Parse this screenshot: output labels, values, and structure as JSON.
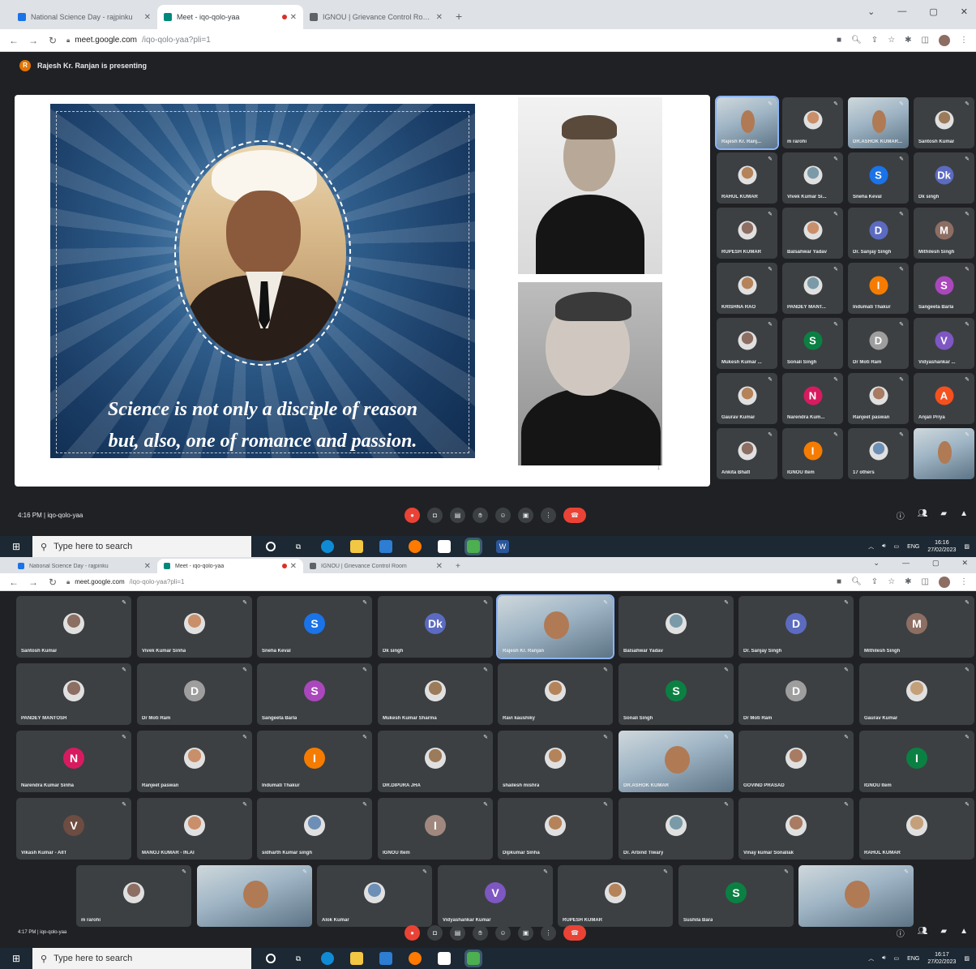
{
  "browser": {
    "tabs": [
      {
        "title": "National Science Day - rajpinku",
        "color": "#1a73e8"
      },
      {
        "title": "Meet - iqo-qolo-yaa",
        "color": "#00897b"
      },
      {
        "title": "IGNOU | Grievance Control Room",
        "color": "#5f6368"
      }
    ],
    "new_tab": "+",
    "url_host": "meet.google.com",
    "url_path": "/iqo-qolo-yaa?pli=1"
  },
  "shot1": {
    "presenting": "Rajesh Kr. Ranjan is presenting",
    "slide": {
      "quote_line1": "Science is not only a disciple of reason",
      "quote_line2": "but, also, one of romance and passion.",
      "page": "1"
    },
    "grid": [
      [
        "Rajesh Kr. Ranj...",
        "m rarohi",
        "DR.ASHOK KUMAR...",
        "Santosh Kumar"
      ],
      [
        "RAHUL KUMAR",
        "Vivek Kumar Si...",
        "Sneha Keval",
        "Dk singh"
      ],
      [
        "RUPESH KUMAR",
        "Balsahwar Yadav",
        "Dr. Sanjay Singh",
        "Mithilesh Singh"
      ],
      [
        "KRISHNA RAO",
        "PANDEY MANT...",
        "Indumati Thakur",
        "Sangeeta Barla"
      ],
      [
        "Mukesh Kumar ...",
        "Sonali Singh",
        "Dr Moti Ram",
        "Vidyashankar ..."
      ],
      [
        "Gaurav Kumar",
        "Narendra Kum...",
        "Ranjeet paswan",
        "Anjali Priya"
      ],
      [
        "Ankita Bhatt",
        "IGNOU Item",
        "17 others",
        ""
      ]
    ],
    "meeting_info": "4:16 PM | iqo-qolo-yaa",
    "search_placeholder": "Type here to search",
    "tray_lang": "ENG",
    "tray_time": "16:16",
    "tray_date": "27/02/2023"
  },
  "shot2": {
    "grid": [
      [
        "Santosh Kumar",
        "Vivek Kumar Sinha",
        "Sneha Keval",
        "Dk singh",
        "Rajesh Kr. Ranjan",
        "Balsahwar Yadav",
        "Dr. Sanjay Singh",
        "Mithilesh Singh"
      ],
      [
        "PANDEY MANTOSH",
        "Dr Moti Ram",
        "Sangeeta Barla",
        "Mukesh Kumar Sharma",
        "Ravi kaushiky",
        "Sonali Singh",
        "Dr Moti Ram",
        "Gaurav Kumar"
      ],
      [
        "Narendra Kumar Sinha",
        "Ranjeet paswan",
        "Indumati Thakur",
        "DR.DIPURA JHA",
        "shailesh mishra",
        "DR.ASHOK KUMAR",
        "GOVIND PRASAD",
        "IGNOU Item"
      ],
      [
        "Vikash Kumar - AIIT",
        "MANOJ KUMAR - IN.AI",
        "sidharth Kumar singh",
        "IGNOU Item",
        "Dipkumar Sinha",
        "Dr. Arbind Tiwary",
        "Vinay kumar Sonaliak",
        "RAHUL KUMAR"
      ],
      [
        "m rarohi",
        "",
        "Alok Kumar",
        "Vidyashankar Kumar",
        "RUPESH KUMAR",
        "Sushila Bara",
        ""
      ]
    ],
    "meeting_info": "4:17 PM | iqo-qolo-yaa",
    "search_placeholder": "Type here to search",
    "tray_lang": "ENG",
    "tray_time": "16:17",
    "tray_date": "27/02/2023"
  },
  "avatars": {
    "S": "#1a73e8",
    "Dk": "#5c6bc0",
    "D": "#5c6bc0",
    "M": "#8d6e63",
    "I": "#f57c00",
    "V": "#7e57c2",
    "N": "#d81b60",
    "A": "#f4511e",
    "Sg": "#ab47bc",
    "Sn": "#0b8043",
    "Dm": "#9e9e9e"
  }
}
